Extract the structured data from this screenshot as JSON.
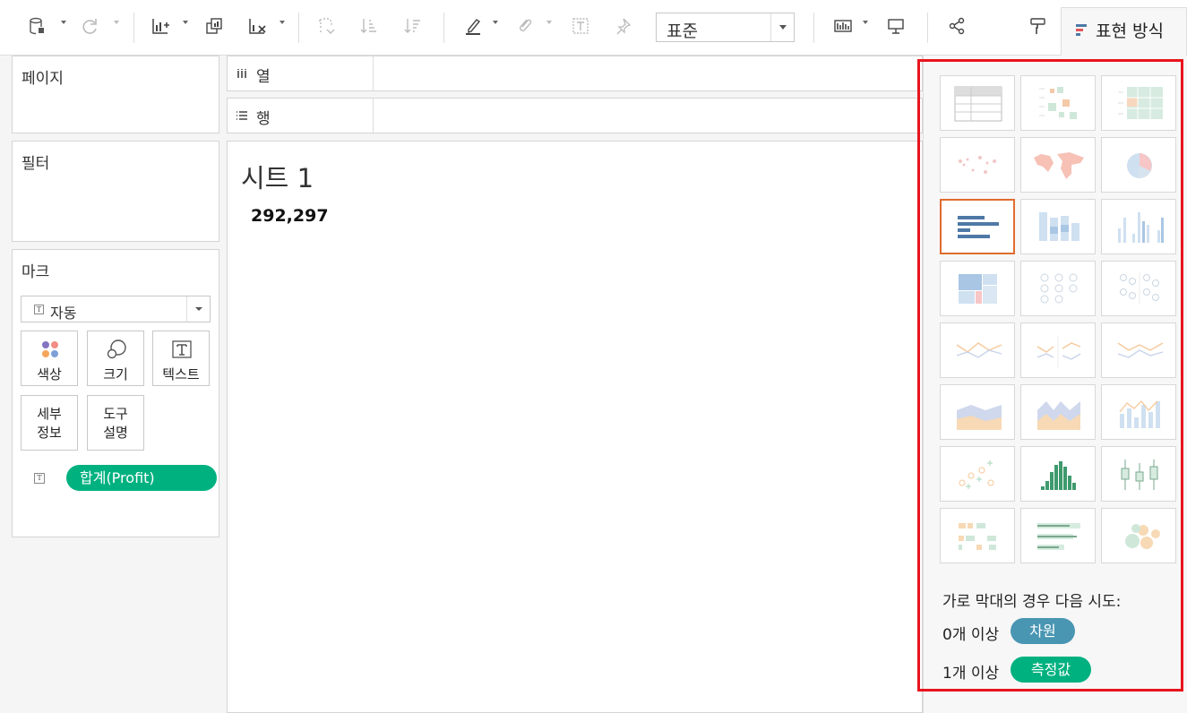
{
  "toolbar": {
    "fit_select": "표준",
    "showme_tab": "표현 방식",
    "icons": [
      "datasource-icon",
      "refresh-icon",
      "new-worksheet-icon",
      "duplicate-icon",
      "clear-sheet-icon",
      "swap-icon",
      "sort-ascending-icon",
      "sort-descending-icon",
      "highlight-icon",
      "group-icon",
      "label-icon",
      "pin-icon",
      "show-cards-icon",
      "presentation-icon",
      "share-icon",
      "format-icon"
    ]
  },
  "cards": {
    "pages": "페이지",
    "filters": "필터",
    "marks": "마크",
    "marks_type": "자동",
    "color": "색상",
    "size": "크기",
    "text": "텍스트",
    "detail": "세부\n정보",
    "detail_1": "세부",
    "detail_2": "정보",
    "tooltip_1": "도구",
    "tooltip_2": "설명",
    "pill": "합계(Profit)"
  },
  "shelves": {
    "columns": "열",
    "rows": "행"
  },
  "view": {
    "sheet_title": "시트 1",
    "value": "292,297"
  },
  "showme": {
    "charts": [
      "text-table",
      "heat-map",
      "highlight-table",
      "symbol-map",
      "filled-map",
      "pie-chart",
      "horizontal-bars",
      "stacked-bars",
      "side-by-side-bars",
      "treemap",
      "circle-views",
      "side-by-side-circles",
      "lines-continuous",
      "lines-discrete",
      "dual-lines",
      "area-continuous",
      "area-discrete",
      "dual-combination",
      "scatter-plot",
      "histogram",
      "box-and-whisker",
      "gantt-chart",
      "bullet-graph",
      "packed-bubbles"
    ],
    "selected": "horizontal-bars",
    "hint": "가로 막대의 경우 다음 시도:",
    "req1_prefix": "0개 이상",
    "req1_badge": "차원",
    "req2_prefix": "1개 이상",
    "req2_badge": "측정값",
    "colors": {
      "dimension": "#4996b2",
      "measure": "#00b180",
      "highlight": "#e8141c",
      "selected": "#e06b2e"
    }
  }
}
